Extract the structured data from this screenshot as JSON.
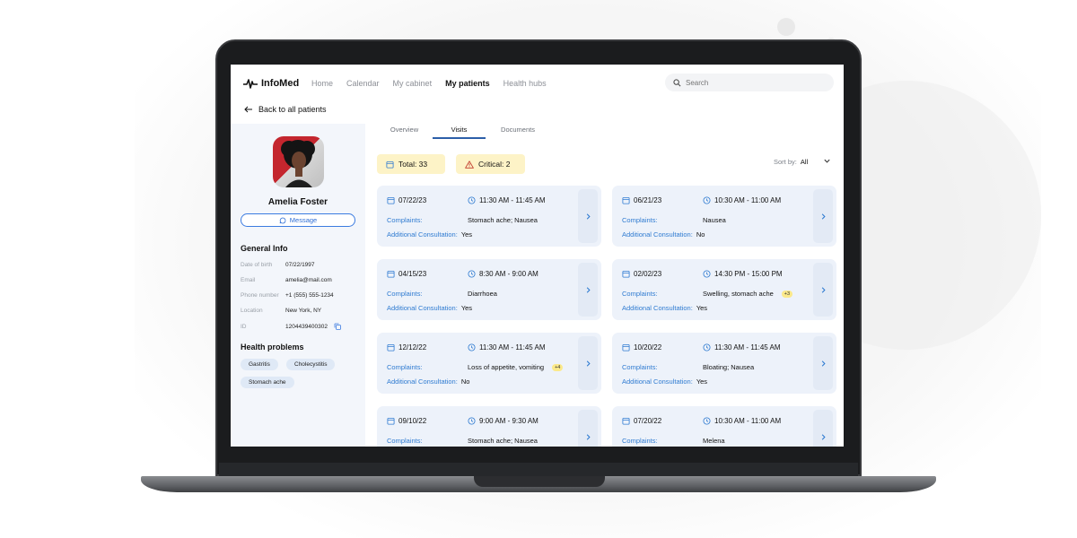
{
  "app": {
    "brand": "InfoMed",
    "nav": [
      {
        "label": "Home",
        "active": false
      },
      {
        "label": "Calendar",
        "active": false
      },
      {
        "label": "My cabinet",
        "active": false
      },
      {
        "label": "My patients",
        "active": true
      },
      {
        "label": "Health hubs",
        "active": false
      }
    ],
    "search_placeholder": "Search"
  },
  "back_link": "Back to all patients",
  "patient": {
    "name": "Amelia Foster",
    "message_label": "Message",
    "general_info_title": "General Info",
    "info": [
      {
        "label": "Date of birth",
        "value": "07/22/1997"
      },
      {
        "label": "Email",
        "value": "amelia@mail.com"
      },
      {
        "label": "Phone number",
        "value": "+1 (555) 555-1234"
      },
      {
        "label": "Location",
        "value": "New York, NY"
      },
      {
        "label": "ID",
        "value": "1204439400302"
      }
    ],
    "health_problems_title": "Health problems",
    "health_problems": [
      "Gastritis",
      "Cholecystitis",
      "Stomach ache"
    ]
  },
  "tabs": [
    {
      "label": "Overview",
      "active": false
    },
    {
      "label": "Visits",
      "active": true
    },
    {
      "label": "Documents",
      "active": false
    }
  ],
  "summary": {
    "total": "Total: 33",
    "critical": "Critical: 2"
  },
  "sort": {
    "label": "Sort by:",
    "value": "All"
  },
  "visit_labels": {
    "complaints": "Complaints:",
    "additional": "Additional Consultation:"
  },
  "visits": [
    {
      "date": "07/22/23",
      "time": "11:30 AM - 11:45 AM",
      "complaints": "Stomach ache; Nausea",
      "extra": "",
      "additional": "Yes"
    },
    {
      "date": "06/21/23",
      "time": "10:30 AM - 11:00 AM",
      "complaints": "Nausea",
      "extra": "",
      "additional": "No"
    },
    {
      "date": "04/15/23",
      "time": "8:30 AM - 9:00 AM",
      "complaints": "Diarrhoea",
      "extra": "",
      "additional": "Yes"
    },
    {
      "date": "02/02/23",
      "time": "14:30 PM - 15:00 PM",
      "complaints": "Swelling, stomach ache",
      "extra": "+3",
      "additional": "Yes"
    },
    {
      "date": "12/12/22",
      "time": "11:30 AM - 11:45 AM",
      "complaints": "Loss of appetite, vomiting",
      "extra": "+4",
      "additional": "No"
    },
    {
      "date": "10/20/22",
      "time": "11:30 AM - 11:45 AM",
      "complaints": "Bloating; Nausea",
      "extra": "",
      "additional": "Yes"
    },
    {
      "date": "09/10/22",
      "time": "9:00 AM - 9:30 AM",
      "complaints": "Stomach ache; Nausea",
      "extra": "",
      "additional": ""
    },
    {
      "date": "07/20/22",
      "time": "10:30 AM - 11:00 AM",
      "complaints": "Melena",
      "extra": "",
      "additional": ""
    }
  ],
  "colors": {
    "accent": "#2f7bd1",
    "summary_bg": "#fdf3c7",
    "card_bg": "#edf2fa",
    "sidebar_bg": "#f3f6fb"
  }
}
